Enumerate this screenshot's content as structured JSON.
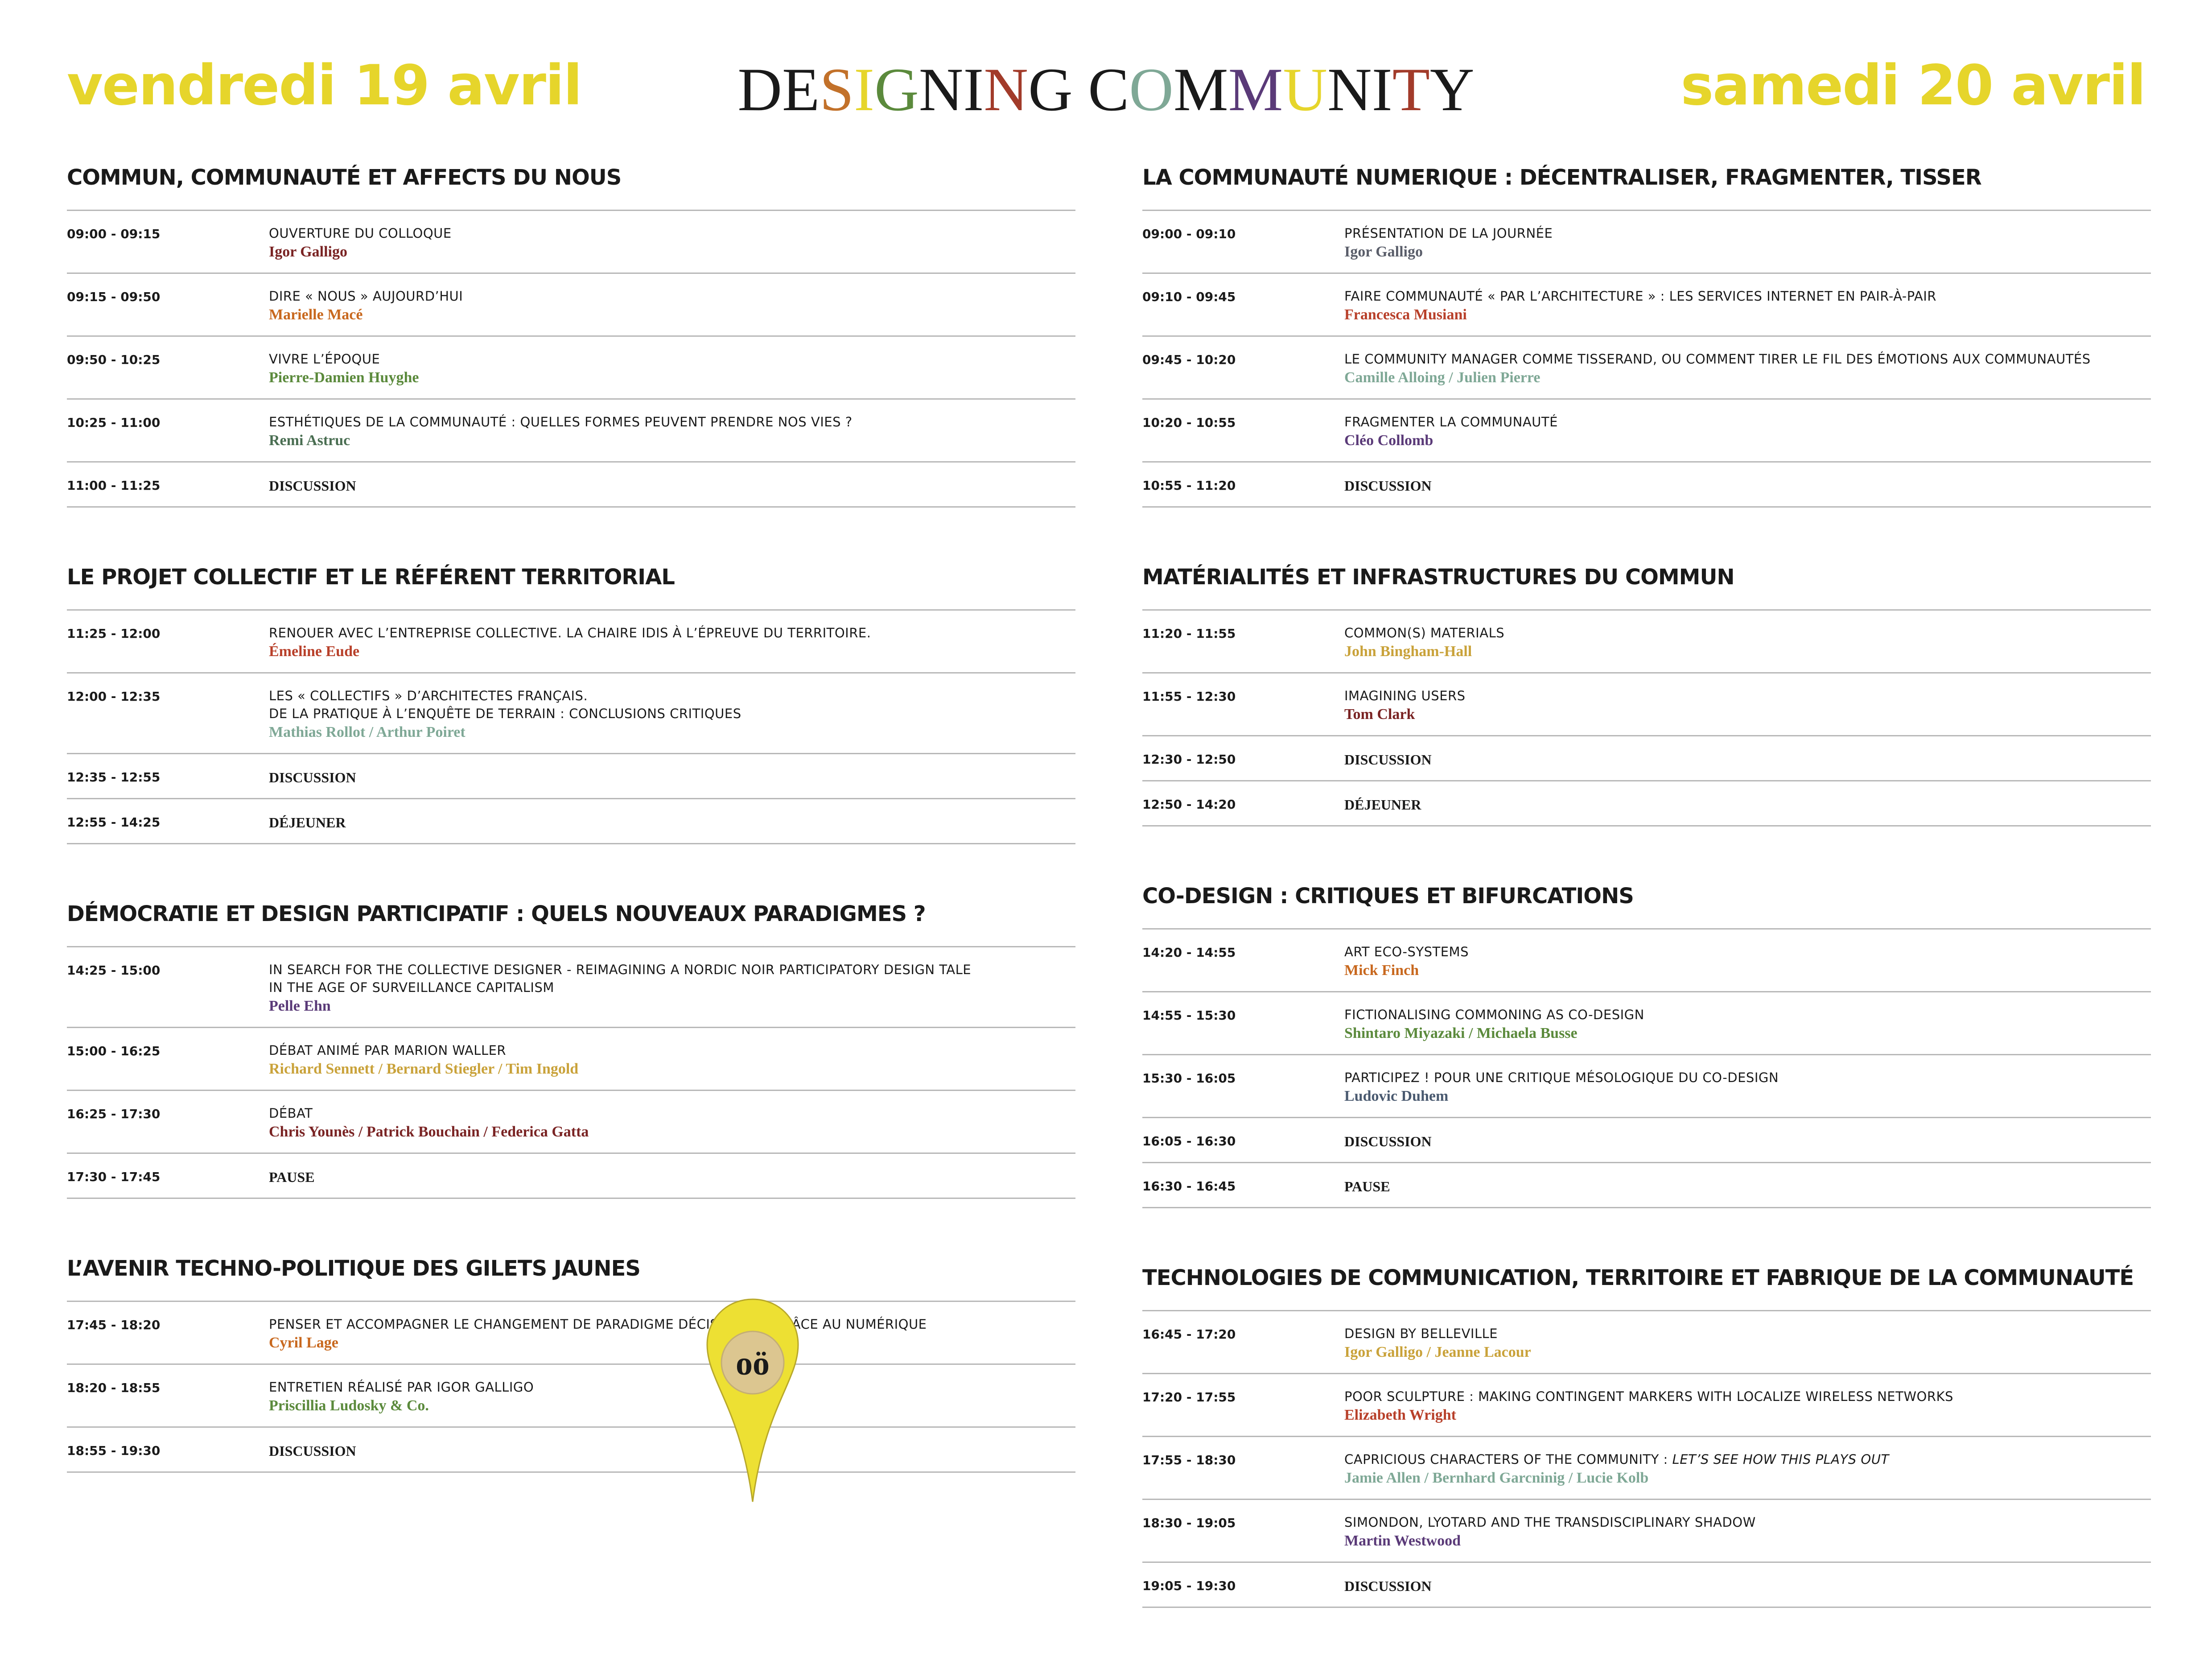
{
  "header": {
    "day_left": "vendredi 19 avril",
    "day_right": "samedi 20 avril",
    "title_letters": [
      {
        "c": "D",
        "color": "#1a1a1a"
      },
      {
        "c": "E",
        "color": "#1a1a1a"
      },
      {
        "c": "S",
        "color": "#c2712a"
      },
      {
        "c": "I",
        "color": "#e6d52b"
      },
      {
        "c": "G",
        "color": "#5b8a3c"
      },
      {
        "c": "N",
        "color": "#1a1a1a"
      },
      {
        "c": "I",
        "color": "#1a1a1a"
      },
      {
        "c": "N",
        "color": "#a23b2a"
      },
      {
        "c": "G",
        "color": "#1a1a1a"
      },
      {
        "c": " ",
        "color": "#1a1a1a"
      },
      {
        "c": "C",
        "color": "#1a1a1a"
      },
      {
        "c": "O",
        "color": "#7fa896"
      },
      {
        "c": "M",
        "color": "#1a1a1a"
      },
      {
        "c": "M",
        "color": "#5a3a78"
      },
      {
        "c": "U",
        "color": "#e6d52b"
      },
      {
        "c": "N",
        "color": "#1a1a1a"
      },
      {
        "c": "I",
        "color": "#1a1a1a"
      },
      {
        "c": "T",
        "color": "#a23b2a"
      },
      {
        "c": "Y",
        "color": "#1a1a1a"
      }
    ],
    "accent_color": "#e6d52b"
  },
  "days": [
    {
      "sections": [
        {
          "title": "COMMUN, COMMUNAUTÉ ET AFFECTS DU NOUS",
          "rows": [
            {
              "time": "09:00 - 09:15",
              "title": "OUVERTURE DU COLLOQUE",
              "speakers": "Igor Galligo",
              "color": "#7a2424"
            },
            {
              "time": "09:15 - 09:50",
              "title": "DIRE « NOUS » AUJOURD’HUI",
              "speakers": "Marielle Macé",
              "color": "#c8681e"
            },
            {
              "time": "09:50 - 10:25",
              "title": "VIVRE L’ÉPOQUE",
              "speakers": "Pierre-Damien Huyghe",
              "color": "#5b8a3c"
            },
            {
              "time": "10:25 - 11:00",
              "title": "ESTHÉTIQUES DE LA COMMUNAUTÉ : QUELLES FORMES PEUVENT PRENDRE NOS VIES ?",
              "speakers": "Remi Astruc",
              "color": "#4a6e52"
            },
            {
              "time": "11:00 - 11:25",
              "big": "DISCUSSION"
            }
          ]
        },
        {
          "title": "LE PROJET COLLECTIF ET LE RÉFÉRENT TERRITORIAL",
          "rows": [
            {
              "time": "11:25 - 12:00",
              "title": "RENOUER AVEC L’ENTREPRISE COLLECTIVE. LA CHAIRE IDIS À L’ÉPREUVE DU TERRITOIRE.",
              "speakers": "Émeline Eude",
              "color": "#b8402a"
            },
            {
              "time": "12:00 - 12:35",
              "title": "LES « COLLECTIFS » D’ARCHITECTES FRANÇAIS.",
              "title2": "DE LA PRATIQUE À L’ENQUÊTE DE TERRAIN : CONCLUSIONS CRITIQUES",
              "speakers": "Mathias Rollot / Arthur Poiret",
              "color": "#7fa896"
            },
            {
              "time": "12:35 - 12:55",
              "big": "DISCUSSION"
            },
            {
              "time": "12:55 - 14:25",
              "big": "DÉJEUNER"
            }
          ]
        },
        {
          "title": "DÉMOCRATIE ET DESIGN PARTICIPATIF : QUELS NOUVEAUX PARADIGMES ?",
          "rows": [
            {
              "time": "14:25 - 15:00",
              "title": "IN SEARCH FOR THE COLLECTIVE DESIGNER - REIMAGINING A NORDIC NOIR PARTICIPATORY DESIGN TALE",
              "title2": "IN THE AGE OF SURVEILLANCE CAPITALISM",
              "speakers": "Pelle Ehn",
              "color": "#5a3a78"
            },
            {
              "time": "15:00 - 16:25",
              "title": "DÉBAT ANIMÉ PAR MARION WALLER",
              "speakers": "Richard Sennett / Bernard Stiegler / Tim Ingold",
              "color": "#c9a23a"
            },
            {
              "time": "16:25 - 17:30",
              "title": "DÉBAT",
              "speakers": "Chris Younès / Patrick Bouchain / Federica Gatta",
              "color": "#7a2424"
            },
            {
              "time": "17:30 - 17:45",
              "big": "PAUSE"
            }
          ]
        },
        {
          "title": "L’AVENIR TECHNO-POLITIQUE DES GILETS JAUNES",
          "rows": [
            {
              "time": "17:45 - 18:20",
              "title": "PENSER ET ACCOMPAGNER LE CHANGEMENT DE PARADIGME DÉCISIONNEL GRÂCE AU NUMÉRIQUE",
              "speakers": "Cyril Lage",
              "color": "#c8681e"
            },
            {
              "time": "18:20 - 18:55",
              "title": "ENTRETIEN RÉALISÉ PAR IGOR GALLIGO",
              "speakers": "Priscillia Ludosky & Co.",
              "color": "#5b8a3c"
            },
            {
              "time": "18:55 - 19:30",
              "big": "DISCUSSION"
            }
          ]
        }
      ]
    },
    {
      "sections": [
        {
          "title": "LA COMMUNAUTÉ NUMERIQUE : DÉCENTRALISER, FRAGMENTER, TISSER",
          "rows": [
            {
              "time": "09:00 - 09:10",
              "title": "PRÉSENTATION DE LA JOURNÉE",
              "speakers": "Igor Galligo",
              "color": "#5a5e6a"
            },
            {
              "time": "09:10 - 09:45",
              "title": "FAIRE COMMUNAUTÉ « PAR L’ARCHITECTURE » : LES SERVICES INTERNET EN PAIR-À-PAIR",
              "speakers": "Francesca Musiani",
              "color": "#b8402a"
            },
            {
              "time": "09:45 - 10:20",
              "title": "LE COMMUNITY MANAGER COMME TISSERAND, OU COMMENT TIRER LE FIL DES ÉMOTIONS AUX COMMUNAUTÉS",
              "speakers": "Camille Alloing / Julien Pierre",
              "color": "#7fa896"
            },
            {
              "time": "10:20 - 10:55",
              "title": "FRAGMENTER LA COMMUNAUTÉ",
              "speakers": "Cléo Collomb",
              "color": "#5a3a78"
            },
            {
              "time": "10:55 - 11:20",
              "big": "DISCUSSION"
            }
          ]
        },
        {
          "title": "MATÉRIALITÉS ET INFRASTRUCTURES DU COMMUN",
          "rows": [
            {
              "time": "11:20 - 11:55",
              "title": "COMMON(S) MATERIALS",
              "speakers": "John Bingham-Hall",
              "color": "#c9a23a"
            },
            {
              "time": "11:55 - 12:30",
              "title": "IMAGINING USERS",
              "speakers": "Tom Clark",
              "color": "#7a2424"
            },
            {
              "time": "12:30 - 12:50",
              "big": "DISCUSSION"
            },
            {
              "time": "12:50 - 14:20",
              "big": "DÉJEUNER"
            }
          ]
        },
        {
          "title": "CO-DESIGN : CRITIQUES ET BIFURCATIONS",
          "rows": [
            {
              "time": "14:20 - 14:55",
              "title": "ART ECO-SYSTEMS",
              "speakers": "Mick Finch",
              "color": "#c8681e"
            },
            {
              "time": "14:55 - 15:30",
              "title": "FICTIONALISING COMMONING AS CO-DESIGN",
              "speakers": "Shintaro Miyazaki / Michaela Busse",
              "color": "#5b8a3c"
            },
            {
              "time": "15:30 - 16:05",
              "title": "PARTICIPEZ ! POUR UNE CRITIQUE MÉSOLOGIQUE DU CO-DESIGN",
              "speakers": "Ludovic Duhem",
              "color": "#4a5a70"
            },
            {
              "time": "16:05 - 16:30",
              "big": "DISCUSSION"
            },
            {
              "time": "16:30 - 16:45",
              "big": "PAUSE"
            }
          ]
        },
        {
          "title": "TECHNOLOGIES DE COMMUNICATION, TERRITOIRE ET FABRIQUE DE LA COMMUNAUTÉ",
          "rows": [
            {
              "time": "16:45 - 17:20",
              "title": "DESIGN BY BELLEVILLE",
              "speakers": "Igor Galligo / Jeanne Lacour",
              "color": "#c9a23a"
            },
            {
              "time": "17:20 - 17:55",
              "title": "POOR SCULPTURE : MAKING CONTINGENT MARKERS WITH LOCALIZE WIRELESS NETWORKS",
              "speakers": "Elizabeth Wright",
              "color": "#b8402a"
            },
            {
              "time": "17:55 - 18:30",
              "title": "CAPRICIOUS CHARACTERS OF THE COMMUNITY : ",
              "title_italic": "LET’S SEE HOW THIS PLAYS OUT",
              "speakers": "Jamie Allen / Bernhard Garcninig / Lucie Kolb",
              "color": "#7fa896"
            },
            {
              "time": "18:30 - 19:05",
              "title": "SIMONDON, LYOTARD AND THE TRANSDISCIPLINARY SHADOW",
              "speakers": "Martin Westwood",
              "color": "#5a3a78"
            },
            {
              "time": "19:05 - 19:30",
              "big": "DISCUSSION"
            }
          ]
        }
      ]
    }
  ],
  "logo": {
    "text": "oö",
    "pin_color": "#ede033"
  }
}
